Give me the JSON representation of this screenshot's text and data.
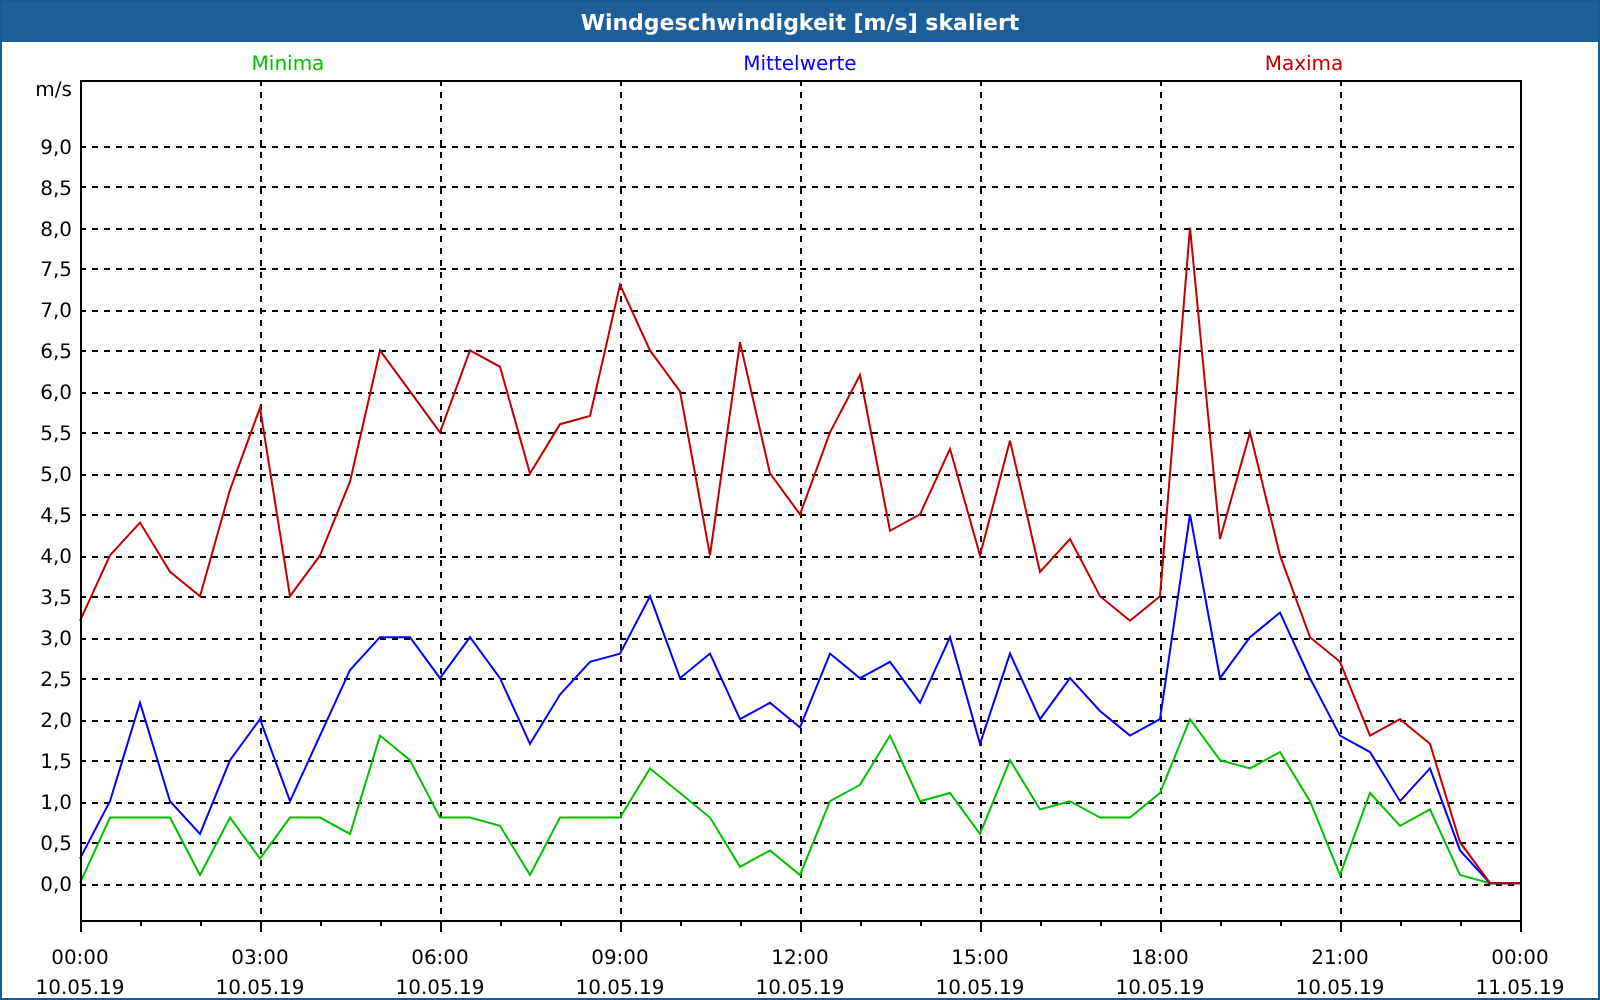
{
  "window": {
    "title": "Windgeschwindigkeit [m/s] skaliert"
  },
  "chart": {
    "chart_data": {
      "type": "line",
      "ylabel": "m/s",
      "categories": [
        "00:00\n10.05.19",
        null,
        null,
        null,
        null,
        null,
        "03:00\n10.05.19",
        null,
        null,
        null,
        null,
        null,
        "06:00\n10.05.19",
        null,
        null,
        null,
        null,
        null,
        "09:00\n10.05.19",
        null,
        null,
        null,
        null,
        null,
        "12:00\n10.05.19",
        null,
        null,
        null,
        null,
        null,
        "15:00\n10.05.19",
        null,
        null,
        null,
        null,
        null,
        "18:00\n10.05.19",
        null,
        null,
        null,
        null,
        null,
        "21:00\n10.05.19",
        null,
        null,
        null,
        null,
        null,
        "00:00\n11.05.19"
      ],
      "series": [
        {
          "name": "Minima",
          "color": "#00c000",
          "values": [
            0,
            0.8,
            0.8,
            0.8,
            0.1,
            0.8,
            0.3,
            0.8,
            0.8,
            0.6,
            1.8,
            1.5,
            0.8,
            0.8,
            0.7,
            0.1,
            0.8,
            0.8,
            0.8,
            1.4,
            1.1,
            0.8,
            0.2,
            0.4,
            0.1,
            1.0,
            1.2,
            1.8,
            1.0,
            1.1,
            0.6,
            1.5,
            0.9,
            1.0,
            0.8,
            0.8,
            1.1,
            2.0,
            1.5,
            1.4,
            1.6,
            1.0,
            0.1,
            1.1,
            0.7,
            0.9,
            0.1,
            0,
            0
          ]
        },
        {
          "name": "Mittelwerte",
          "color": "#0000ff",
          "values": [
            0.3,
            1.0,
            2.2,
            1.0,
            0.6,
            1.5,
            2.0,
            1.0,
            1.8,
            2.6,
            3.0,
            3.0,
            2.5,
            3.0,
            2.5,
            1.7,
            2.3,
            2.7,
            2.8,
            3.5,
            2.5,
            2.8,
            2.0,
            2.2,
            1.9,
            2.8,
            2.5,
            2.7,
            2.2,
            3.0,
            1.7,
            2.8,
            2.0,
            2.5,
            2.1,
            1.8,
            2.0,
            4.5,
            2.5,
            3.0,
            3.3,
            2.5,
            1.8,
            1.6,
            1.0,
            1.4,
            0.4,
            0,
            0
          ]
        },
        {
          "name": "Maxima",
          "color": "#c00000",
          "values": [
            3.2,
            4.0,
            4.4,
            3.8,
            3.5,
            4.8,
            5.8,
            3.5,
            4.0,
            4.9,
            6.5,
            6.0,
            5.5,
            6.5,
            6.3,
            5.0,
            5.6,
            5.7,
            7.3,
            6.5,
            6.0,
            4.0,
            6.6,
            5.0,
            4.5,
            5.5,
            6.2,
            4.3,
            4.5,
            5.3,
            4.0,
            5.4,
            3.8,
            4.2,
            3.5,
            3.2,
            3.5,
            8.0,
            4.2,
            5.5,
            4.0,
            3.0,
            2.7,
            1.8,
            2.0,
            1.7,
            0.5,
            0,
            0
          ]
        }
      ],
      "ylim": [
        -0.45,
        9.8
      ],
      "grid": true,
      "yticks": [
        {
          "value": 0,
          "label": "0,0"
        },
        {
          "value": 0.5,
          "label": "0,5"
        },
        {
          "value": 1,
          "label": "1,0"
        },
        {
          "value": 1.5,
          "label": "1,5"
        },
        {
          "value": 2,
          "label": "2,0"
        },
        {
          "value": 2.5,
          "label": "2,5"
        },
        {
          "value": 3,
          "label": "3,0"
        },
        {
          "value": 3.5,
          "label": "3,5"
        },
        {
          "value": 4,
          "label": "4,0"
        },
        {
          "value": 4.5,
          "label": "4,5"
        },
        {
          "value": 5,
          "label": "5,0"
        },
        {
          "value": 5.5,
          "label": "5,5"
        },
        {
          "value": 6,
          "label": "6,0"
        },
        {
          "value": 6.5,
          "label": "6,5"
        },
        {
          "value": 7,
          "label": "7,0"
        },
        {
          "value": 7.5,
          "label": "7,5"
        },
        {
          "value": 8,
          "label": "8,0"
        },
        {
          "value": 8.5,
          "label": "8,5"
        },
        {
          "value": 9,
          "label": "9,0"
        }
      ]
    }
  }
}
